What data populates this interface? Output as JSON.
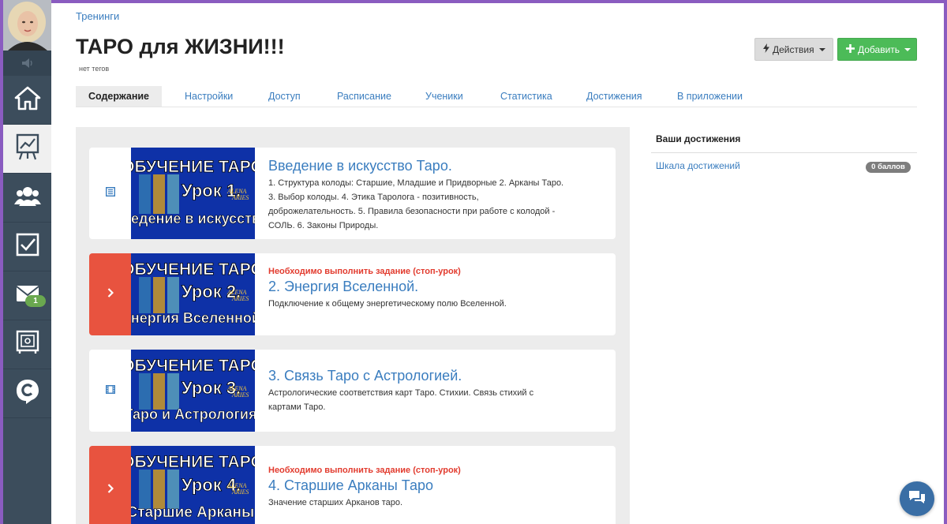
{
  "breadcrumb": "Тренинги",
  "page_title": "ТАРО для ЖИЗНИ!!!",
  "tags": "нет тегов",
  "actions_button": "Действия",
  "add_button": "Добавить",
  "tabs": [
    {
      "label": "Содержание",
      "active": true
    },
    {
      "label": "Настройки"
    },
    {
      "label": "Доступ"
    },
    {
      "label": "Расписание"
    },
    {
      "label": "Ученики"
    },
    {
      "label": "Статистика"
    },
    {
      "label": "Достижения"
    },
    {
      "label": "В приложении"
    }
  ],
  "sidebar": {
    "items": [
      {
        "icon": "home-icon"
      },
      {
        "icon": "chart-board-icon",
        "active": true
      },
      {
        "icon": "users-icon"
      },
      {
        "icon": "checkbox-icon"
      },
      {
        "icon": "mail-icon",
        "badge": "1"
      },
      {
        "icon": "safe-icon"
      },
      {
        "icon": "chat-c-icon"
      }
    ]
  },
  "lessons": [
    {
      "icon": "document-icon",
      "thumb": {
        "line1": "ОБУЧЕНИЕ ТАРО",
        "line2": "Урок 1.",
        "line3": "Введение в искусство.",
        "brand1": "ALENA",
        "brand2": "ARIES"
      },
      "title": "Введение в искусство Таро.",
      "description": "1. Структура колоды: Старшие, Младшие и Придворные 2. Арканы Таро. 3. Выбор колоды. 4. Этика Таролога - позитивность, доброжелательность. 5. Правила безопасности при работе с колодой - СОЛЬ. 6. Законы Природы."
    },
    {
      "icon": "chevron-right-icon",
      "stop_label": "Необходимо выполнить задание (стоп-урок)",
      "thumb": {
        "line1": "ОБУЧЕНИЕ ТАРО",
        "line2": "Урок 2.",
        "line3": "Энергия Вселенной.",
        "brand1": "ALENA",
        "brand2": "ARIES"
      },
      "title": "2. Энергия Вселенной.",
      "description": "Подключение к общему энергетическому полю Вселенной."
    },
    {
      "icon": "film-icon",
      "thumb": {
        "line1": "ОБУЧЕНИЕ ТАРО",
        "line2": "Урок 3.",
        "line3": "Таро и Астрология.",
        "brand1": "ALENA",
        "brand2": "ARIES"
      },
      "title": "3. Связь Таро с Астрологией.",
      "description": "Астрологические соответствия карт Таро. Стихии. Связь стихий с картами Таро."
    },
    {
      "icon": "chevron-right-icon",
      "stop_label": "Необходимо выполнить задание (стоп-урок)",
      "thumb": {
        "line1": "ОБУЧЕНИЕ ТАРО",
        "line2": "Урок 4.",
        "line3": "Старшие Арканы.",
        "brand1": "ALENA",
        "brand2": "ARIES"
      },
      "title": "4. Старшие Арканы Таро",
      "description": "Значение старших Арканов таро."
    }
  ],
  "achievements": {
    "header": "Ваши достижения",
    "link": "Шкала достижений",
    "badge": "0 баллов"
  },
  "colors": {
    "accent": "#3a7dbf",
    "add_button": "#4cbb58",
    "stop_lesson": "#e8533f",
    "sidebar": "#3c4d5c"
  }
}
